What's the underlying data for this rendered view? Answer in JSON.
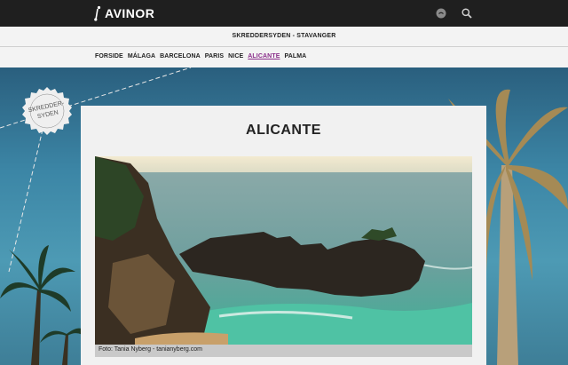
{
  "header": {
    "brand": "AVINOR",
    "icons": [
      "share-icon",
      "search-icon"
    ]
  },
  "subheader": {
    "title": "SKREDDERSYDEN - STAVANGER"
  },
  "nav": {
    "items": [
      {
        "label": "FORSIDE",
        "active": false
      },
      {
        "label": "MÁLAGA",
        "active": false
      },
      {
        "label": "BARCELONA",
        "active": false
      },
      {
        "label": "PARIS",
        "active": false
      },
      {
        "label": "NICE",
        "active": false
      },
      {
        "label": "ALICANTE",
        "active": true
      },
      {
        "label": "PALMA",
        "active": false
      }
    ]
  },
  "badge": {
    "line1": "SKREDDER-",
    "line2": "SYDEN"
  },
  "main": {
    "title": "ALICANTE",
    "photo_caption": "Foto: Tania Nyberg - tanianyberg.com"
  },
  "colors": {
    "topbar": "#1f1f1f",
    "active_nav": "#8a2d8a",
    "card": "#f1f1f1",
    "sky": "#3c86a6"
  }
}
